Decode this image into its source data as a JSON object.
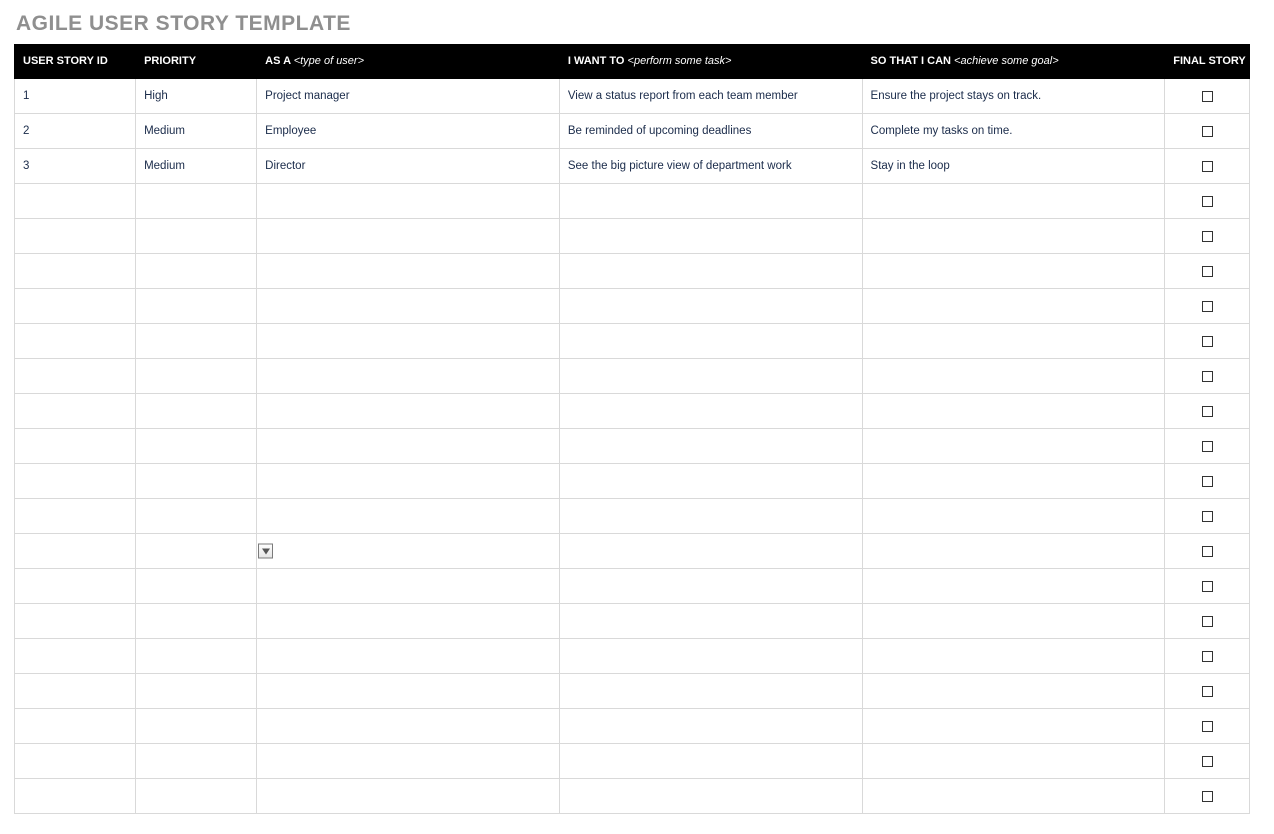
{
  "title": "AGILE USER STORY TEMPLATE",
  "headers": {
    "id": "USER STORY ID",
    "priority": "PRIORITY",
    "asa_prefix": "AS A ",
    "asa_hint": "<type of user>",
    "want_prefix": "I WANT TO ",
    "want_hint": "<perform some task>",
    "goal_prefix": "SO THAT I CAN ",
    "goal_hint": "<achieve some goal>",
    "final": "FINAL STORY"
  },
  "rows": [
    {
      "id": "1",
      "priority": "High",
      "asa": "Project manager",
      "want": "View a status report from each team member",
      "goal": "Ensure the project stays on track.",
      "final_checked": false,
      "dropdown_visible": false
    },
    {
      "id": "2",
      "priority": "Medium",
      "asa": "Employee",
      "want": "Be reminded of upcoming deadlines",
      "goal": "Complete my tasks on time.",
      "final_checked": false,
      "dropdown_visible": false
    },
    {
      "id": "3",
      "priority": "Medium",
      "asa": "Director",
      "want": "See the big picture view of department work",
      "goal": "Stay in the loop",
      "final_checked": false,
      "dropdown_visible": false
    },
    {
      "id": "",
      "priority": "",
      "asa": "",
      "want": "",
      "goal": "",
      "final_checked": false,
      "dropdown_visible": false
    },
    {
      "id": "",
      "priority": "",
      "asa": "",
      "want": "",
      "goal": "",
      "final_checked": false,
      "dropdown_visible": false
    },
    {
      "id": "",
      "priority": "",
      "asa": "",
      "want": "",
      "goal": "",
      "final_checked": false,
      "dropdown_visible": false
    },
    {
      "id": "",
      "priority": "",
      "asa": "",
      "want": "",
      "goal": "",
      "final_checked": false,
      "dropdown_visible": false
    },
    {
      "id": "",
      "priority": "",
      "asa": "",
      "want": "",
      "goal": "",
      "final_checked": false,
      "dropdown_visible": false
    },
    {
      "id": "",
      "priority": "",
      "asa": "",
      "want": "",
      "goal": "",
      "final_checked": false,
      "dropdown_visible": false
    },
    {
      "id": "",
      "priority": "",
      "asa": "",
      "want": "",
      "goal": "",
      "final_checked": false,
      "dropdown_visible": false
    },
    {
      "id": "",
      "priority": "",
      "asa": "",
      "want": "",
      "goal": "",
      "final_checked": false,
      "dropdown_visible": false
    },
    {
      "id": "",
      "priority": "",
      "asa": "",
      "want": "",
      "goal": "",
      "final_checked": false,
      "dropdown_visible": false
    },
    {
      "id": "",
      "priority": "",
      "asa": "",
      "want": "",
      "goal": "",
      "final_checked": false,
      "dropdown_visible": false
    },
    {
      "id": "",
      "priority": "",
      "asa": "",
      "want": "",
      "goal": "",
      "final_checked": false,
      "dropdown_visible": true
    },
    {
      "id": "",
      "priority": "",
      "asa": "",
      "want": "",
      "goal": "",
      "final_checked": false,
      "dropdown_visible": false
    },
    {
      "id": "",
      "priority": "",
      "asa": "",
      "want": "",
      "goal": "",
      "final_checked": false,
      "dropdown_visible": false
    },
    {
      "id": "",
      "priority": "",
      "asa": "",
      "want": "",
      "goal": "",
      "final_checked": false,
      "dropdown_visible": false
    },
    {
      "id": "",
      "priority": "",
      "asa": "",
      "want": "",
      "goal": "",
      "final_checked": false,
      "dropdown_visible": false
    },
    {
      "id": "",
      "priority": "",
      "asa": "",
      "want": "",
      "goal": "",
      "final_checked": false,
      "dropdown_visible": false
    },
    {
      "id": "",
      "priority": "",
      "asa": "",
      "want": "",
      "goal": "",
      "final_checked": false,
      "dropdown_visible": false
    },
    {
      "id": "",
      "priority": "",
      "asa": "",
      "want": "",
      "goal": "",
      "final_checked": false,
      "dropdown_visible": false
    }
  ]
}
